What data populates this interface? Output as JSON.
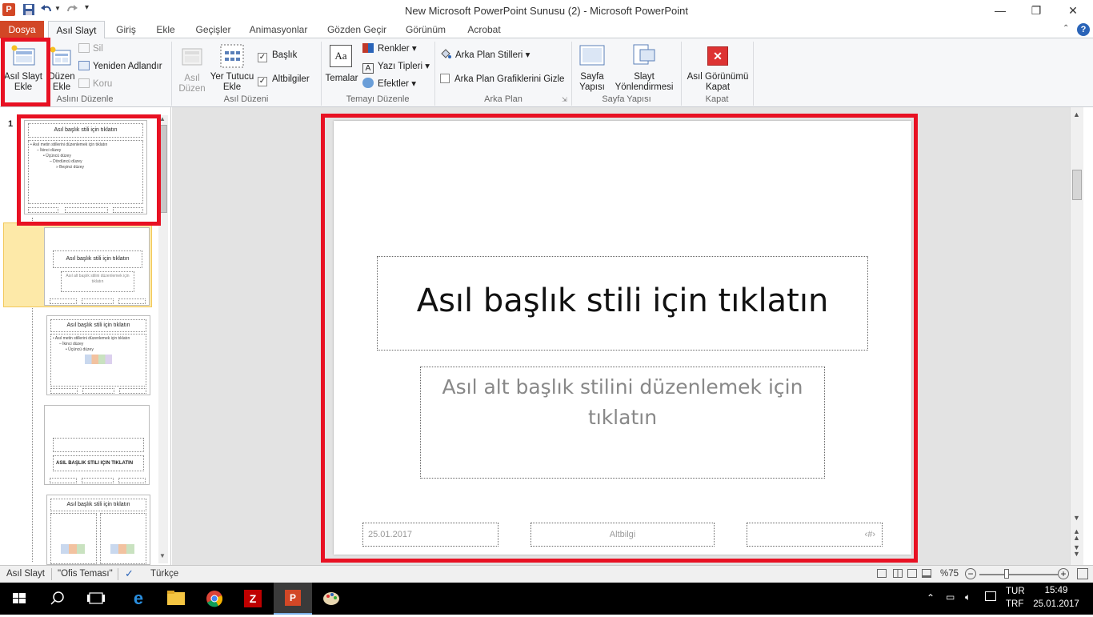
{
  "window": {
    "title": "New Microsoft PowerPoint Sunusu (2)  -  Microsoft PowerPoint",
    "minimize": "—",
    "restore": "❐",
    "close": "✕"
  },
  "tabs": [
    {
      "label": "Dosya"
    },
    {
      "label": "Asıl Slayt"
    },
    {
      "label": "Giriş"
    },
    {
      "label": "Ekle"
    },
    {
      "label": "Geçişler"
    },
    {
      "label": "Animasyonlar"
    },
    {
      "label": "Gözden Geçir"
    },
    {
      "label": "Görünüm"
    },
    {
      "label": "Acrobat"
    }
  ],
  "ribbon": {
    "groups": {
      "edit_master": {
        "label": "Aslını Düzenle",
        "insert_master": "Asıl Slayt Ekle",
        "insert_layout": "Düzen Ekle",
        "delete": "Sil",
        "rename": "Yeniden Adlandır",
        "preserve": "Koru"
      },
      "master_layout": {
        "label": "Asıl Düzeni",
        "master_layout_btn": "Asıl Düzen",
        "insert_placeholder": "Yer Tutucu Ekle",
        "title_cb": "Başlık",
        "footers_cb": "Altbilgiler"
      },
      "edit_theme": {
        "label": "Temayı Düzenle",
        "themes": "Temalar",
        "colors": "Renkler",
        "fonts": "Yazı Tipleri",
        "effects": "Efektler"
      },
      "background": {
        "label": "Arka Plan",
        "bg_styles": "Arka Plan Stilleri",
        "hide_bg": "Arka Plan Grafiklerini Gizle"
      },
      "page_setup": {
        "label": "Sayfa Yapısı",
        "page_setup_btn": "Sayfa Yapısı",
        "orientation": "Slayt Yönlendirmesi"
      },
      "close": {
        "label": "Kapat",
        "close_master": "Asıl Görünümü Kapat"
      }
    }
  },
  "thumbnails": {
    "slide_number": "1",
    "master_title": "Asıl başlık stili için tıklatın",
    "master_body": [
      "• Asıl metin stillerini düzenlemek için tıklatın",
      "– İkinci düzey",
      "• Üçüncü düzey",
      "– Dördüncü düzey",
      "» Beşinci düzey"
    ],
    "layout2_title": "Asıl başlık stili için tıklatın",
    "layout2_sub": "Asıl alt başlık stilini düzenlemek için tıklatın",
    "layout3_title": "Asıl başlık stili için tıklatın",
    "layout4_title": "ASIL BAŞLIK STILI IÇIN TIKLATIN",
    "layout5_title": "Asıl başlık stili için tıklatın"
  },
  "slide": {
    "title": "Asıl başlık stili için tıklatın",
    "subtitle": "Asıl alt başlık stilini düzenlemek için tıklatın",
    "date": "25.01.2017",
    "footer": "Altbilgi",
    "number": "‹#›"
  },
  "status": {
    "view": "Asıl Slayt",
    "theme": "\"Ofis Teması\"",
    "language": "Türkçe",
    "zoom": "%75"
  },
  "taskbar": {
    "lang1": "TUR",
    "lang2": "TRF",
    "time": "15:49",
    "date": "25.01.2017"
  },
  "colors": {
    "highlight_red": "#e81123",
    "file_tab": "#d24726"
  }
}
